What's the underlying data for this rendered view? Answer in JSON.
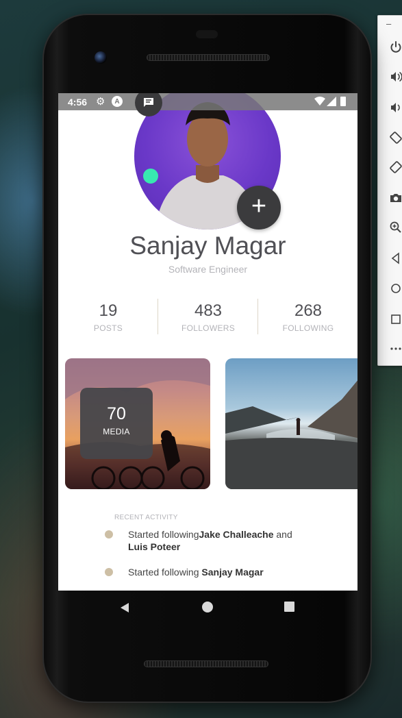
{
  "status_bar": {
    "time": "4:56"
  },
  "profile": {
    "name": "Sanjay Magar",
    "role": "Software Engineer"
  },
  "stats": [
    {
      "value": "19",
      "label": "POSTS"
    },
    {
      "value": "483",
      "label": "FOLLOWERS"
    },
    {
      "value": "268",
      "label": "FOLLOWING"
    }
  ],
  "media": {
    "count": "70",
    "label": "MEDIA"
  },
  "recent_activity": {
    "title": "RECENT ACTIVITY",
    "items": [
      {
        "prefix": "Started following",
        "name1": "Jake Challeache",
        "joiner": " and ",
        "name2": "Luis Poteer"
      },
      {
        "prefix": "Started following ",
        "name1": "Sanjay Magar"
      }
    ]
  },
  "colors": {
    "accent_online": "#38e8b0",
    "fab": "#3b3b3d",
    "avatar_bg": "#6a38c8"
  },
  "icons": {
    "toolbar": [
      "power-icon",
      "volume-up-icon",
      "volume-down-icon",
      "rotate-left-icon",
      "rotate-right-icon",
      "camera-icon",
      "zoom-icon",
      "back-icon",
      "home-icon",
      "overview-icon",
      "more-icon"
    ]
  }
}
